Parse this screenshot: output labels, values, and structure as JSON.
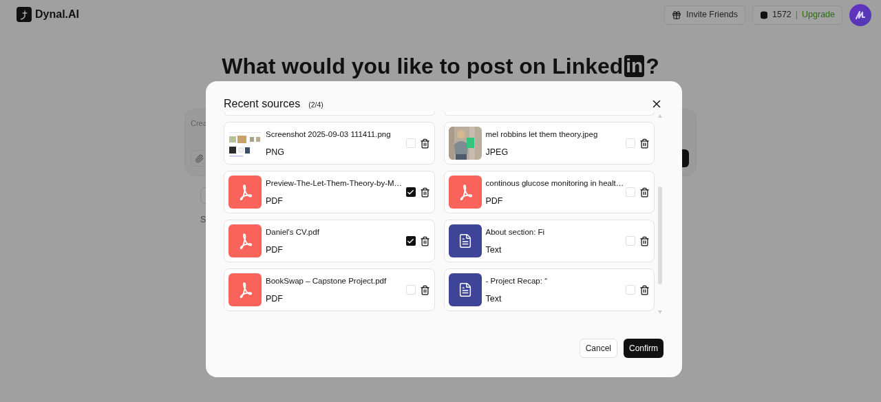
{
  "header": {
    "logo": "Dynal.AI",
    "invite_button": "Invite Friends",
    "credits": "1572",
    "separator": "|",
    "upgrade": "Upgrade"
  },
  "background": {
    "headline": "What would you like to post on Linked",
    "headline_badge": "in",
    "headline_end": "?",
    "prompt_placeholder": "Crea",
    "section_label": "S"
  },
  "dialog": {
    "title": "Recent sources",
    "count": "(2/4)",
    "sources": [
      {
        "name": "Screenshot 2025-09-03 111411.png",
        "type": "PNG",
        "kind": "screenshot",
        "checked": false
      },
      {
        "name": "mel robbins let them theory.jpeg",
        "type": "JPEG",
        "checked": false
      },
      {
        "name": "Preview-The-Let-Them-Theory-by-M…",
        "type": "PDF",
        "kind": "pdf",
        "checked": true
      },
      {
        "name": "continous glucose monitoring in healt…",
        "type": "PDF",
        "kind": "pdf",
        "checked": false
      },
      {
        "name": "Daniel's CV.pdf",
        "type": "PDF",
        "kind": "pdf",
        "checked": true
      },
      {
        "name": "About section: Fi",
        "type": "Text",
        "kind": "text",
        "checked": false
      },
      {
        "name": "BookSwap – Capstone Project.pdf",
        "type": "PDF",
        "kind": "pdf",
        "checked": false
      },
      {
        "name": "- Project Recap: “",
        "type": "Text",
        "kind": "text",
        "checked": false
      }
    ],
    "cancel": "Cancel",
    "confirm": "Confirm"
  }
}
